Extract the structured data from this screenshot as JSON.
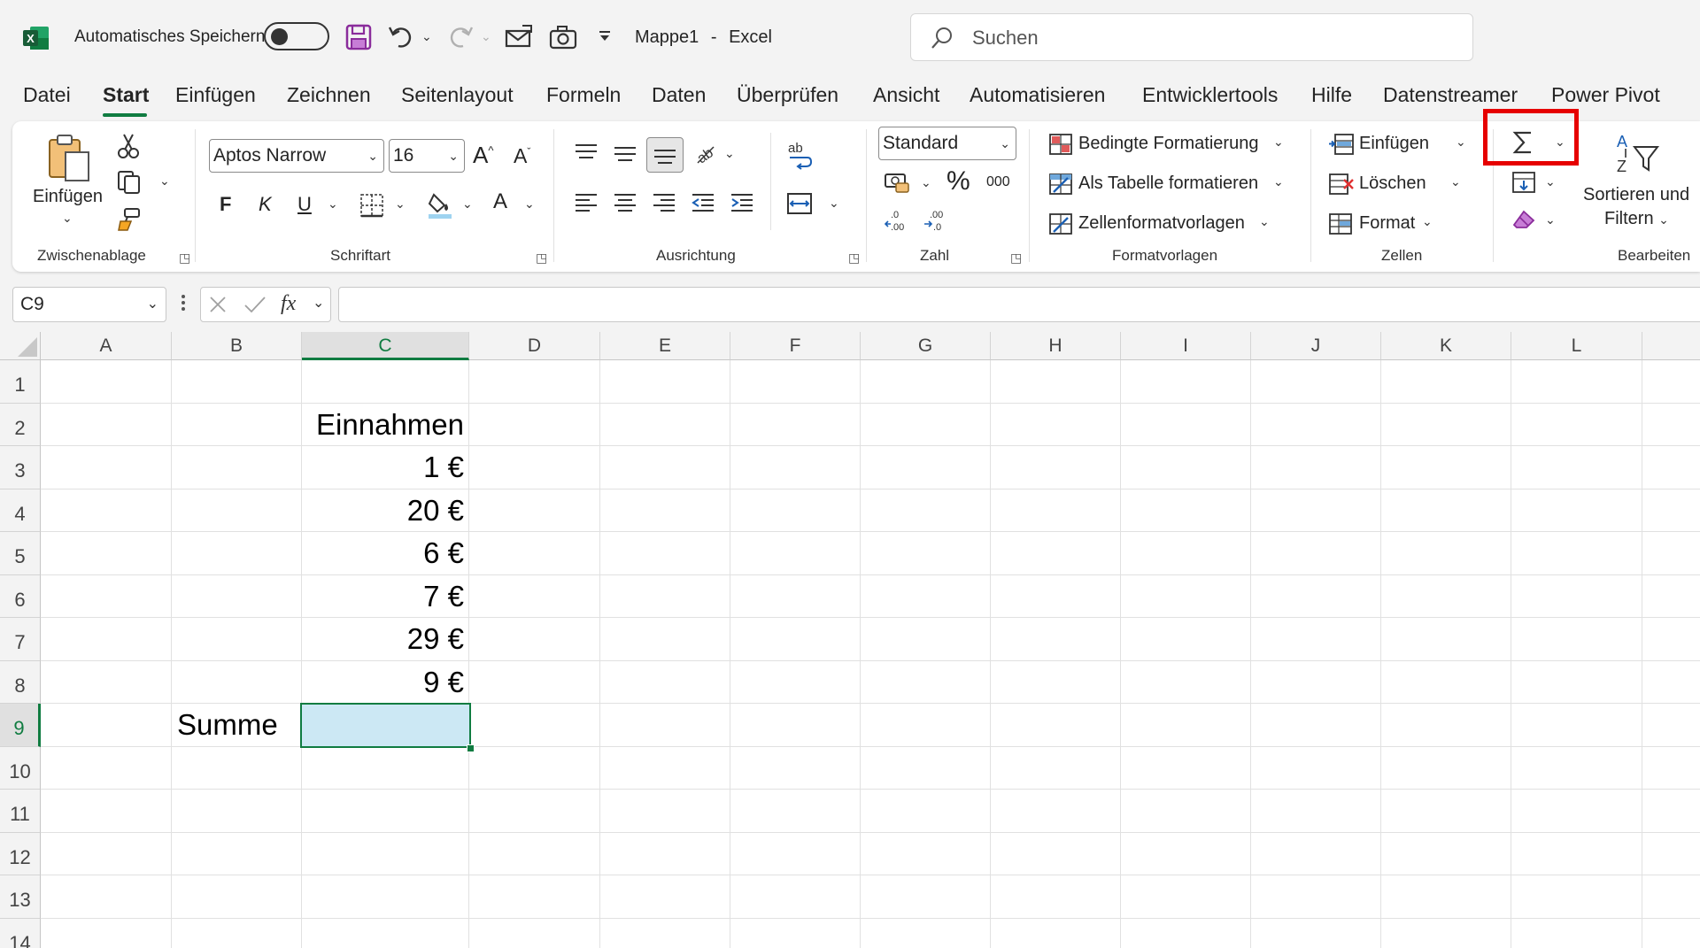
{
  "titlebar": {
    "autosave_label": "Automatisches Speichern",
    "filename": "Mappe1",
    "separator": "-",
    "app_name": "Excel",
    "search_placeholder": "Suchen"
  },
  "menu": [
    "Datei",
    "Start",
    "Einfügen",
    "Zeichnen",
    "Seitenlayout",
    "Formeln",
    "Daten",
    "Überprüfen",
    "Ansicht",
    "Automatisieren",
    "Entwicklertools",
    "Hilfe",
    "Datenstreamer",
    "Power Pivot"
  ],
  "ribbon": {
    "clipboard": {
      "paste_label": "Einfügen",
      "group": "Zwischenablage"
    },
    "font": {
      "name": "Aptos Narrow",
      "size": "16",
      "bold": "F",
      "italic": "K",
      "underline": "U",
      "group": "Schriftart"
    },
    "alignment": {
      "group": "Ausrichtung"
    },
    "number": {
      "format": "Standard",
      "percent": "%",
      "thousands": "000",
      "group": "Zahl"
    },
    "styles": {
      "conditional": "Bedingte Formatierung",
      "as_table": "Als Tabelle formatieren",
      "cell_styles": "Zellenformatvorlagen",
      "group": "Formatvorlagen"
    },
    "cells": {
      "insert": "Einfügen",
      "delete": "Löschen",
      "format": "Format",
      "group": "Zellen"
    },
    "editing": {
      "sort_line1": "Sortieren und",
      "sort_line2": "Filtern",
      "group": "Bearbeiten"
    }
  },
  "formula_bar": {
    "name_box": "C9",
    "fx": "fx",
    "formula": ""
  },
  "columns": [
    "A",
    "B",
    "C",
    "D",
    "E",
    "F",
    "G",
    "H",
    "I",
    "J",
    "K",
    "L"
  ],
  "rows": [
    "1",
    "2",
    "3",
    "4",
    "5",
    "6",
    "7",
    "8",
    "9",
    "10",
    "11",
    "12",
    "13",
    "14"
  ],
  "cells": {
    "C2": "Einnahmen",
    "C3": "1 €",
    "C4": "20 €",
    "C5": "6 €",
    "C6": "7 €",
    "C7": "29 €",
    "C8": "9 €",
    "B9": "Summe"
  },
  "selected_cell": "C9",
  "colors": {
    "excel_green": "#107c41",
    "highlight": "#e60000",
    "selection_fill": "#cce8f4"
  }
}
